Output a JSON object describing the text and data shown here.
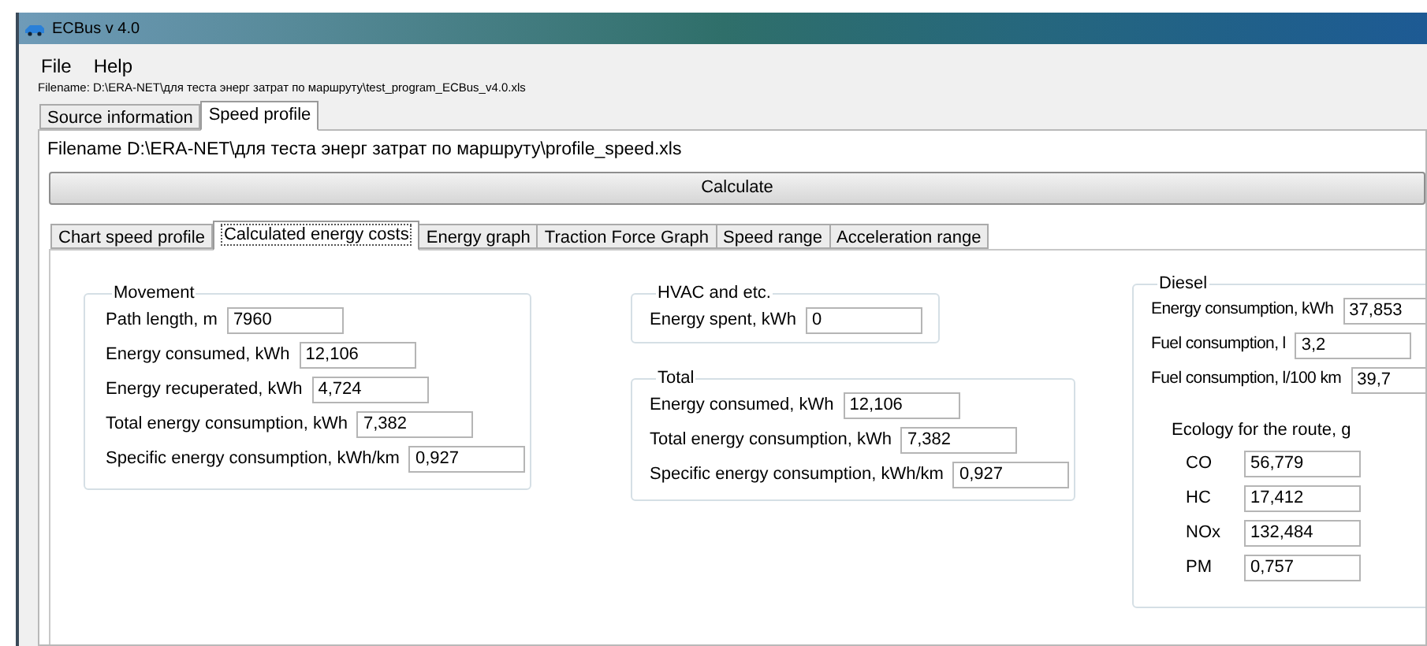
{
  "window": {
    "title": "ECBus v 4.0"
  },
  "menu": [
    "File",
    "Help"
  ],
  "file_path": "Filename:  D:\\ERA-NET\\для теста энерг затрат по маршруту\\test_program_ECBus_v4.0.xls",
  "tabs": [
    {
      "label": "Source information",
      "selected": false
    },
    {
      "label": "Speed profile",
      "selected": true
    }
  ],
  "profile_filename": "Filename D:\\ERA-NET\\для теста энерг затрат по маршруту\\profile_speed.xls",
  "calculate_button": "Calculate",
  "inner_tabs": [
    {
      "label": "Chart speed profile",
      "selected": false
    },
    {
      "label": "Calculated energy costs",
      "selected": true
    },
    {
      "label": "Energy graph",
      "selected": false
    },
    {
      "label": "Traction Force Graph",
      "selected": false
    },
    {
      "label": "Speed range",
      "selected": false
    },
    {
      "label": "Acceleration range",
      "selected": false
    }
  ],
  "movement": {
    "title": "Movement",
    "fields": [
      {
        "label": "Path length, m",
        "value": "7960"
      },
      {
        "label": "Energy consumed, kWh",
        "value": "12,106"
      },
      {
        "label": "Energy recuperated, kWh",
        "value": "4,724"
      },
      {
        "label": "Total energy consumption, kWh",
        "value": "7,382"
      },
      {
        "label": "Specific energy consumption, kWh/km",
        "value": "0,927"
      }
    ]
  },
  "hvac": {
    "title": "HVAC and etc.",
    "fields": [
      {
        "label": "Energy spent, kWh",
        "value": "0"
      }
    ]
  },
  "total": {
    "title": "Total",
    "fields": [
      {
        "label": "Energy consumed, kWh",
        "value": "12,106"
      },
      {
        "label": "Total energy consumption, kWh",
        "value": "7,382"
      },
      {
        "label": "Specific energy consumption, kWh/km",
        "value": "0,927"
      }
    ]
  },
  "diesel": {
    "title": "Diesel",
    "fields": [
      {
        "label": "Energy consumption, kWh",
        "value": "37,853"
      },
      {
        "label": "Fuel consumption, l",
        "value": "3,2"
      },
      {
        "label": "Fuel consumption, l/100 km",
        "value": "39,7"
      }
    ],
    "ecology": {
      "title": "Ecology for the route, g",
      "fields": [
        {
          "label": "CO",
          "value": "56,779"
        },
        {
          "label": "HC",
          "value": "17,412"
        },
        {
          "label": "NOx",
          "value": "132,484"
        },
        {
          "label": "PM",
          "value": "0,757"
        }
      ]
    }
  }
}
